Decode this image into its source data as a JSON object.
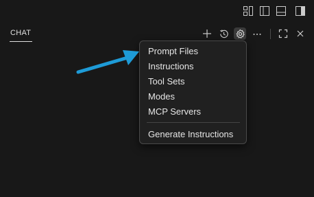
{
  "header": {
    "tab_label": "CHAT"
  },
  "titlebar_icons": [
    "customize-layout-icon",
    "toggle-primary-sidebar-icon",
    "toggle-panel-icon",
    "toggle-secondary-sidebar-icon"
  ],
  "header_icons": [
    "plus-icon",
    "history-icon",
    "gear-icon",
    "more-icon",
    "maximize-icon",
    "close-icon"
  ],
  "menu": {
    "items": [
      {
        "label": "Prompt Files"
      },
      {
        "label": "Instructions"
      },
      {
        "label": "Tool Sets"
      },
      {
        "label": "Modes"
      },
      {
        "label": "MCP Servers"
      }
    ],
    "footer_item": {
      "label": "Generate Instructions"
    }
  },
  "colors": {
    "background": "#181818",
    "menu_background": "#202020",
    "text": "#e6e6e6",
    "annotation_arrow": "#1e9bd7"
  }
}
